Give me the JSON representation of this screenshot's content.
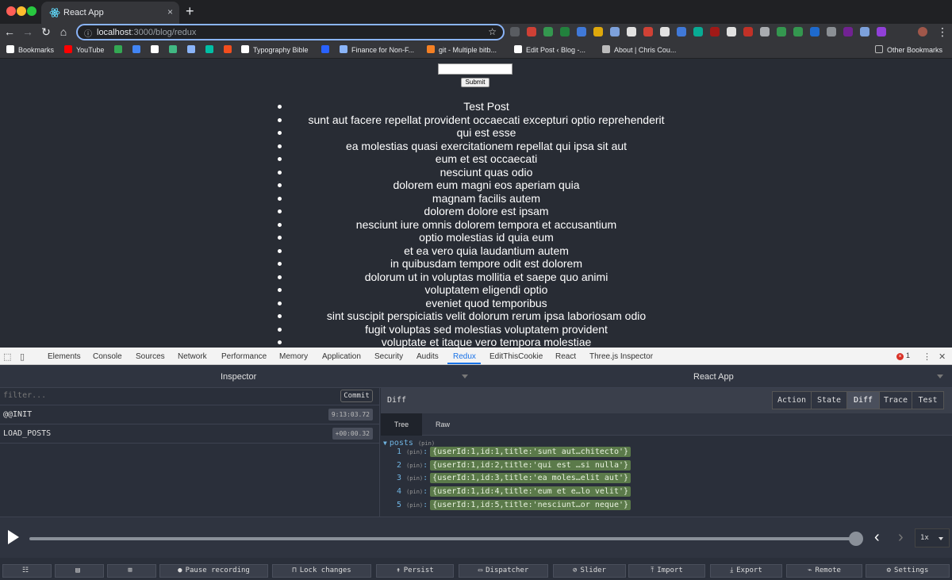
{
  "browser": {
    "tab_title": "React App",
    "url_host": "localhost",
    "url_path": ":3000/blog/redux",
    "new_tab": "+",
    "close_tab": "×"
  },
  "bookmarks": [
    {
      "label": "Bookmarks",
      "icon": "star-icon",
      "color": "#ffffff"
    },
    {
      "label": "YouTube",
      "icon": "youtube-icon",
      "color": "#ff0000"
    },
    {
      "label": "",
      "icon": "drive-icon",
      "color": "#34a853"
    },
    {
      "label": "",
      "icon": "docs-icon",
      "color": "#4285f4"
    },
    {
      "label": "",
      "icon": "codepen-icon",
      "color": "#ffffff"
    },
    {
      "label": "",
      "icon": "vue-icon",
      "color": "#41b883"
    },
    {
      "label": "",
      "icon": "wand-icon",
      "color": "#8ab4f8"
    },
    {
      "label": "",
      "icon": "drop-icon",
      "color": "#00bfa5"
    },
    {
      "label": "",
      "icon": "figma-icon",
      "color": "#f24e1e"
    },
    {
      "label": "Typography Bible",
      "icon": "pt-icon",
      "color": "#ffffff"
    },
    {
      "label": "",
      "icon": "c-icon",
      "color": "#2962ff"
    },
    {
      "label": "Finance for Non-F...",
      "icon": "link-icon",
      "color": "#8ab4f8"
    },
    {
      "label": "git - Multiple bitb...",
      "icon": "git-icon",
      "color": "#f48024"
    },
    {
      "label": "Edit Post ‹ Blog -...",
      "icon": "wordpress-icon",
      "color": "#ffffff"
    },
    {
      "label": "About | Chris Cou...",
      "icon": "avatar-icon",
      "color": "#bbbbbb"
    }
  ],
  "other_bookmarks": "Other Bookmarks",
  "form": {
    "submit_label": "Submit",
    "input_value": ""
  },
  "posts": [
    "Test Post",
    "sunt aut facere repellat provident occaecati excepturi optio reprehenderit",
    "qui est esse",
    "ea molestias quasi exercitationem repellat qui ipsa sit aut",
    "eum et est occaecati",
    "nesciunt quas odio",
    "dolorem eum magni eos aperiam quia",
    "magnam facilis autem",
    "dolorem dolore est ipsam",
    "nesciunt iure omnis dolorem tempora et accusantium",
    "optio molestias id quia eum",
    "et ea vero quia laudantium autem",
    "in quibusdam tempore odit est dolorem",
    "dolorum ut in voluptas mollitia et saepe quo animi",
    "voluptatem eligendi optio",
    "eveniet quod temporibus",
    "sint suscipit perspiciatis velit dolorum rerum ipsa laboriosam odio",
    "fugit voluptas sed molestias voluptatem provident",
    "voluptate et itaque vero tempora molestiae"
  ],
  "devtools": {
    "tabs": [
      "Elements",
      "Console",
      "Sources",
      "Network",
      "Performance",
      "Memory",
      "Application",
      "Security",
      "Audits",
      "Redux",
      "EditThisCookie",
      "React",
      "Three.js Inspector"
    ],
    "active_tab": "Redux",
    "error_count": "1"
  },
  "redux": {
    "left_title": "Inspector",
    "right_title": "React App",
    "filter_placeholder": "filter...",
    "commit_label": "Commit",
    "actions": [
      {
        "name": "@@INIT",
        "time": "9:13:03.72"
      },
      {
        "name": "LOAD_POSTS",
        "time": "+00:00.32"
      }
    ],
    "panel_title": "Diff",
    "segments": [
      "Action",
      "State",
      "Diff",
      "Trace",
      "Test"
    ],
    "active_segment": "Diff",
    "subtabs": [
      "Tree",
      "Raw"
    ],
    "tree_root": "posts",
    "pin_label": "(pin)",
    "tree_rows": [
      {
        "key": "1",
        "value": "{userId:1,id:1,title:'sunt aut…chitecto'}"
      },
      {
        "key": "2",
        "value": "{userId:1,id:2,title:'qui est …si nulla'}"
      },
      {
        "key": "3",
        "value": "{userId:1,id:3,title:'ea moles…elit aut'}"
      },
      {
        "key": "4",
        "value": "{userId:1,id:4,title:'eum et e…lo velit'}"
      },
      {
        "key": "5",
        "value": "{userId:1,id:5,title:'nesciunt…or neque'}"
      }
    ],
    "speed": "1x",
    "slider_position": 1.0,
    "bottom_buttons": [
      {
        "label": "",
        "icon": "log-monitor-icon"
      },
      {
        "label": "",
        "icon": "inspector-icon"
      },
      {
        "label": "",
        "icon": "chart-icon"
      },
      {
        "label": "Pause recording",
        "icon": "pause-icon"
      },
      {
        "label": "Lock changes",
        "icon": "lock-icon"
      },
      {
        "label": "Persist",
        "icon": "pin-icon"
      },
      {
        "label": "Dispatcher",
        "icon": "keyboard-icon"
      },
      {
        "label": "Slider",
        "icon": "slider-icon"
      },
      {
        "label": "Import",
        "icon": "import-icon"
      },
      {
        "label": "Export",
        "icon": "export-icon"
      },
      {
        "label": "Remote",
        "icon": "remote-icon"
      },
      {
        "label": "Settings",
        "icon": "gear-icon"
      }
    ]
  }
}
